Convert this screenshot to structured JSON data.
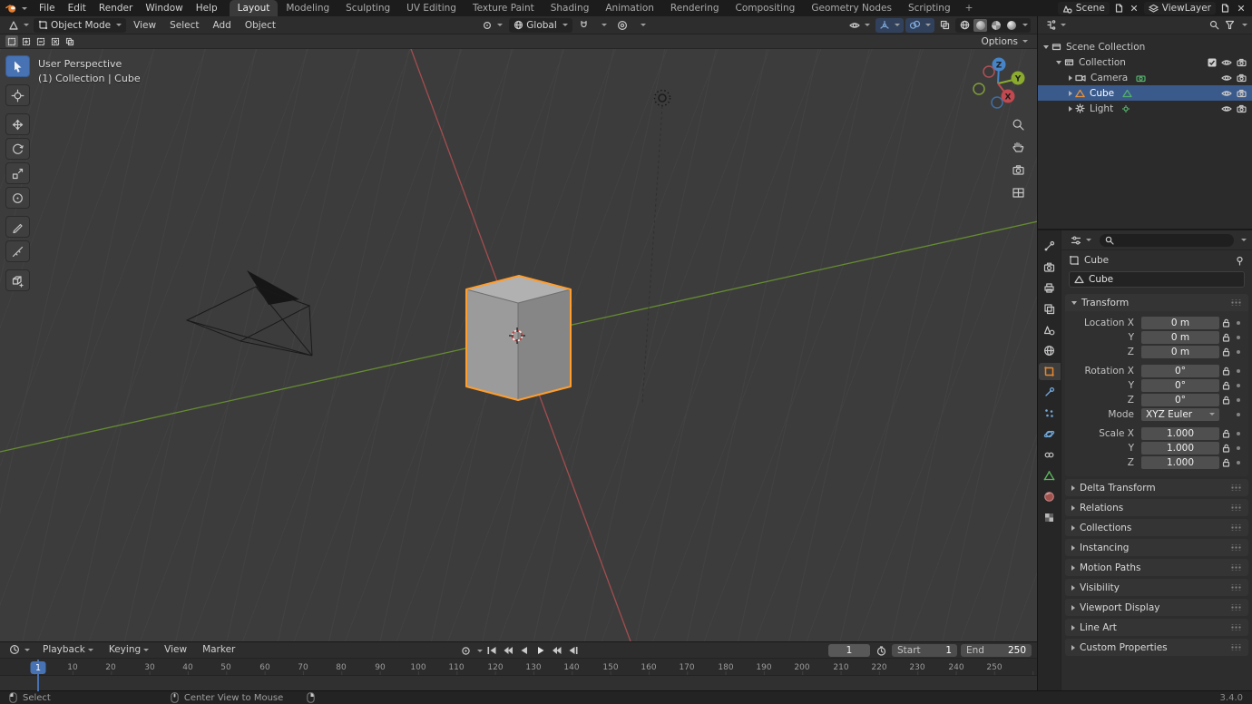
{
  "colors": {
    "accent_blue": "#4772b3",
    "object_active_outline": "#ff9d2d",
    "axis_x": "#b04f52",
    "axis_y": "#6d9b30",
    "axis_z": "#4584c7"
  },
  "topbar": {
    "menus": [
      "File",
      "Edit",
      "Render",
      "Window",
      "Help"
    ],
    "workspaces": [
      "Layout",
      "Modeling",
      "Sculpting",
      "UV Editing",
      "Texture Paint",
      "Shading",
      "Animation",
      "Rendering",
      "Compositing",
      "Geometry Nodes",
      "Scripting"
    ],
    "add_workspace": "+",
    "scene": {
      "label": "Scene"
    },
    "view_layer": {
      "label": "ViewLayer"
    }
  },
  "viewport": {
    "header": {
      "mode": "Object Mode",
      "menus": [
        "View",
        "Select",
        "Add",
        "Object"
      ],
      "orientation": "Global"
    },
    "tool_settings": {
      "options": "Options"
    },
    "overlay": {
      "perspective": "User Perspective",
      "context": "(1) Collection | Cube"
    },
    "gizmo": {
      "x": "X",
      "y": "Y",
      "z": "Z"
    }
  },
  "outliner": {
    "rows": [
      {
        "label": "Scene Collection"
      },
      {
        "label": "Collection"
      },
      {
        "label": "Camera"
      },
      {
        "label": "Cube"
      },
      {
        "label": "Light"
      }
    ]
  },
  "properties": {
    "breadcrumb": "Cube",
    "object_name": "Cube",
    "transform": {
      "title": "Transform",
      "rows": [
        {
          "label": "Location X",
          "value": "0 m"
        },
        {
          "label": "Y",
          "value": "0 m"
        },
        {
          "label": "Z",
          "value": "0 m"
        },
        {
          "label": "Rotation X",
          "value": "0°"
        },
        {
          "label": "Y",
          "value": "0°"
        },
        {
          "label": "Z",
          "value": "0°"
        },
        {
          "label": "Mode",
          "value": "XYZ Euler"
        },
        {
          "label": "Scale X",
          "value": "1.000"
        },
        {
          "label": "Y",
          "value": "1.000"
        },
        {
          "label": "Z",
          "value": "1.000"
        }
      ]
    },
    "panels": [
      "Delta Transform",
      "Relations",
      "Collections",
      "Instancing",
      "Motion Paths",
      "Visibility",
      "Viewport Display",
      "Line Art",
      "Custom Properties"
    ]
  },
  "timeline": {
    "menus": [
      "Playback",
      "Keying",
      "View",
      "Marker"
    ],
    "current_frame": "1",
    "start_label": "Start",
    "start_value": "1",
    "end_label": "End",
    "end_value": "250",
    "ticks": [
      "10",
      "20",
      "30",
      "40",
      "50",
      "60",
      "70",
      "80",
      "90",
      "100",
      "110",
      "120",
      "130",
      "140",
      "150",
      "160",
      "170",
      "180",
      "190",
      "200",
      "210",
      "220",
      "230",
      "240",
      "250"
    ]
  },
  "statusbar": {
    "items": [
      {
        "label": "Select"
      },
      {
        "label": "Center View to Mouse"
      }
    ],
    "version": "3.4.0"
  }
}
